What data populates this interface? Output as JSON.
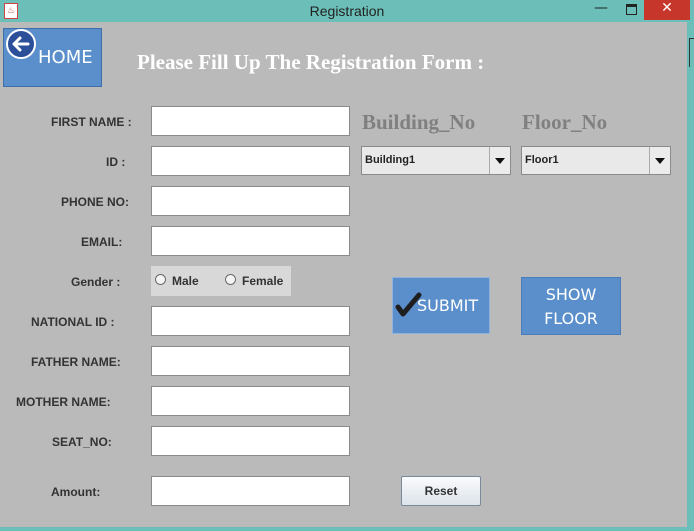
{
  "window": {
    "title": "Registration",
    "app_icon": "java-icon",
    "minimize_glyph": "—",
    "close_glyph": "✕"
  },
  "home_button": {
    "label": "HOME",
    "icon": "back-arrow-icon"
  },
  "form_title": "Please Fill Up The Registration Form :",
  "fields": {
    "first_name": {
      "label": "FIRST NAME :",
      "value": ""
    },
    "id": {
      "label": "ID :",
      "value": ""
    },
    "phone_no": {
      "label": "PHONE NO:",
      "value": ""
    },
    "email": {
      "label": "EMAIL:",
      "value": ""
    },
    "national_id": {
      "label": "NATIONAL ID :",
      "value": ""
    },
    "father_name": {
      "label": "FATHER NAME:",
      "value": ""
    },
    "mother_name": {
      "label": "MOTHER NAME:",
      "value": ""
    },
    "seat_no": {
      "label": "SEAT_NO:",
      "value": ""
    },
    "amount": {
      "label": "Amount:",
      "value": ""
    }
  },
  "gender": {
    "label": "Gender :",
    "options": [
      "Male",
      "Female"
    ],
    "selected": null
  },
  "building": {
    "heading": "Building_No",
    "selected": "Building1"
  },
  "floor": {
    "heading": "Floor_No",
    "selected": "Floor1"
  },
  "buttons": {
    "submit": "SUBMIT",
    "show_floor_line1": "SHOW",
    "show_floor_line2": "FLOOR",
    "reset": "Reset"
  },
  "colors": {
    "window_frame": "#6bbfb8",
    "background": "#bbbaba",
    "button_blue": "#5b8fcb",
    "close_red": "#c7362a",
    "heading_gray": "#808080"
  }
}
